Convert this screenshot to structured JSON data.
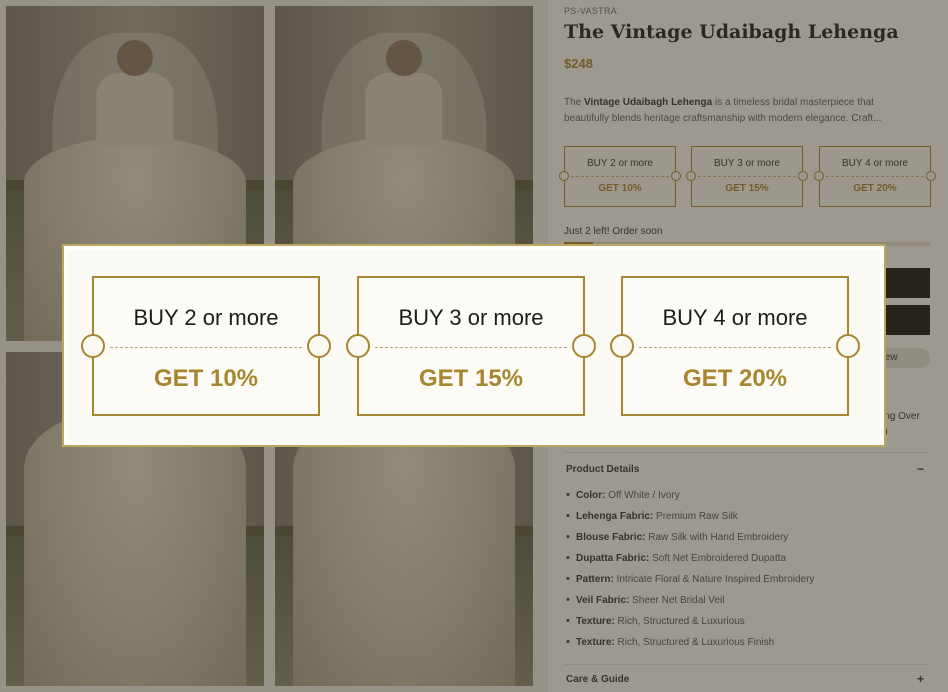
{
  "product": {
    "brand": "PS-VASTRA",
    "title": "The Vintage Udaibagh Lehenga",
    "price": "$248",
    "description_prefix": "The ",
    "description_bold": "Vintage Udaibagh Lehenga",
    "description_rest": " is a timeless bridal masterpiece that beautifully blends heritage craftsmanship with modern elegance. Craft..."
  },
  "offers": [
    {
      "label": "BUY 2 or more",
      "discount": "GET 10%"
    },
    {
      "label": "BUY 3 or more",
      "discount": "GET 15%"
    },
    {
      "label": "BUY 4 or more",
      "discount": "GET 20%"
    }
  ],
  "stock": {
    "message": "Just 2 left! Order soon"
  },
  "partially_hidden": {
    "review_text": "eview",
    "shipping_text": "ing Over",
    "shipping_icon": "♀",
    "shipping_suffix": "0"
  },
  "accordion": {
    "product_details": {
      "title": "Product Details",
      "toggle": "−"
    },
    "care_guide": {
      "title": "Care & Guide",
      "toggle": "+"
    }
  },
  "details": [
    {
      "key": "Color:",
      "value": "Off White / Ivory"
    },
    {
      "key": "Lehenga Fabric:",
      "value": "Premium Raw Silk"
    },
    {
      "key": "Blouse Fabric:",
      "value": "Raw Silk with Hand Embroidery"
    },
    {
      "key": "Dupatta Fabric:",
      "value": "Soft Net Embroidered Dupatta"
    },
    {
      "key": "Pattern:",
      "value": "Intricate Floral & Nature Inspired Embroidery"
    },
    {
      "key": "Veil Fabric:",
      "value": "Sheer Net Bridal Veil"
    },
    {
      "key": "Texture:",
      "value": "Rich, Structured & Luxurious"
    },
    {
      "key": "Texture:",
      "value": "Rich, Structured & Luxurious Finish"
    }
  ],
  "popup_offers": [
    {
      "label": "BUY 2 or more",
      "discount": "GET 10%"
    },
    {
      "label": "BUY 3 or more",
      "discount": "GET 15%"
    },
    {
      "label": "BUY 4 or more",
      "discount": "GET 20%"
    }
  ],
  "colors": {
    "accent_gold": "#a8862f",
    "overlay": "rgba(60,52,35,0.5)"
  }
}
